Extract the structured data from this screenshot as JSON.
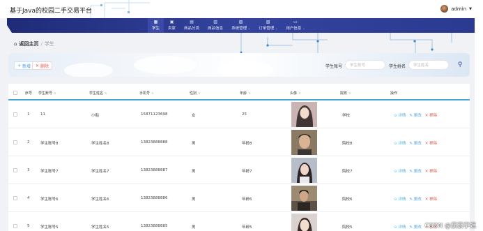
{
  "header": {
    "app_title": "基于Java的校园二手交易平台",
    "username": "admin",
    "colors": {
      "band": "#2e3c92",
      "band_dark": "#1e2a74",
      "accent": "#3b4aa6"
    }
  },
  "nav": {
    "items": [
      {
        "label": "学生",
        "icon": "grid-icon",
        "active": true
      },
      {
        "label": "卖家",
        "icon": "person-icon"
      },
      {
        "label": "商品分类",
        "icon": "category-icon"
      },
      {
        "label": "商品信息",
        "icon": "goods-icon"
      },
      {
        "label": "系统管理",
        "icon": "settings-icon"
      },
      {
        "label": "订单管理",
        "icon": "order-icon"
      },
      {
        "label": "用户信息",
        "icon": "user-card-icon"
      }
    ]
  },
  "breadcrumb": {
    "home": "返回主页",
    "current": "学生"
  },
  "toolbar": {
    "add_label": "新增",
    "delete_label": "删除"
  },
  "search": {
    "field1_label": "学生账号",
    "field1_placeholder": "学生账号",
    "field2_label": "学生姓名",
    "field2_placeholder": "学生姓名"
  },
  "table": {
    "headers": [
      "序号",
      "学生账号",
      "学生姓名",
      "手机号",
      "性别",
      "年龄",
      "头像",
      "院校",
      "操作"
    ],
    "actions": {
      "detail": "详情",
      "edit": "更改",
      "delete": "移除"
    },
    "rows": [
      {
        "idx": "1",
        "account": "11",
        "name": "小船",
        "phone": "15871123698",
        "gender": "女",
        "age": "25",
        "college": "学校",
        "photo": "girl"
      },
      {
        "idx": "2",
        "account": "学生账号8",
        "name": "学生姓名8",
        "phone": "13823888888",
        "gender": "男",
        "age": "年龄8",
        "college": "院校8",
        "photo": "boy"
      },
      {
        "idx": "3",
        "account": "学生账号7",
        "name": "学生姓名7",
        "phone": "13823888887",
        "gender": "男",
        "age": "年龄7",
        "college": "院校7",
        "photo": "girl2"
      },
      {
        "idx": "4",
        "account": "学生账号6",
        "name": "学生姓名6",
        "phone": "13823888886",
        "gender": "男",
        "age": "年龄6",
        "college": "院校6",
        "photo": "boy2"
      },
      {
        "idx": "5",
        "account": "学生账号5",
        "name": "学生姓名5",
        "phone": "13823888885",
        "gender": "男",
        "age": "年龄5",
        "college": "院校5",
        "photo": "girl3"
      }
    ]
  },
  "watermark": "CSDN @茄茄学姐"
}
